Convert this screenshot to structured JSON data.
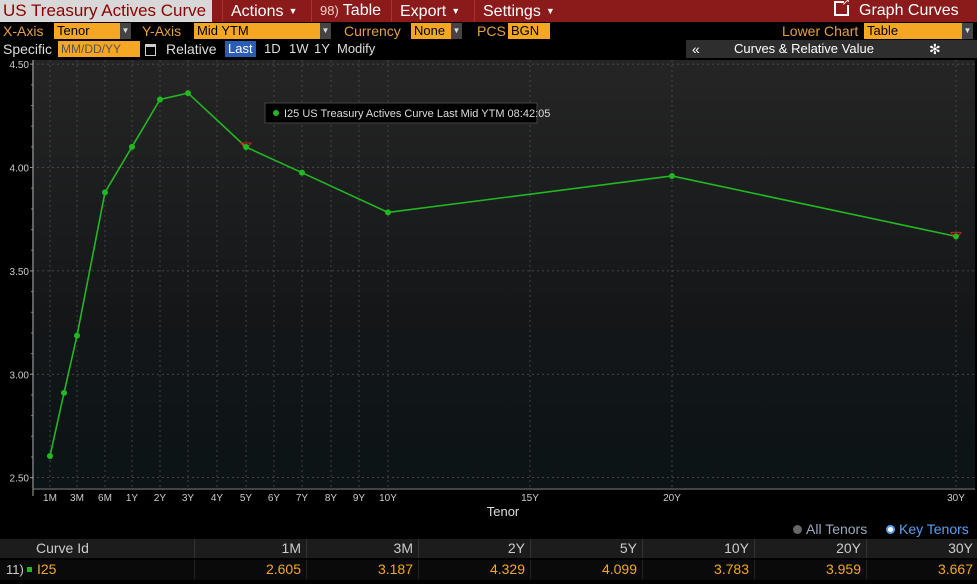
{
  "menu": {
    "title": "US Treasury Actives Curve",
    "actions": "Actions",
    "table_num": "98)",
    "table": "Table",
    "export": "Export",
    "settings": "Settings",
    "graph_curves": "Graph Curves"
  },
  "settings_row": {
    "xaxis_label": "X-Axis",
    "xaxis_value": "Tenor",
    "yaxis_label": "Y-Axis",
    "yaxis_value": "Mid YTM",
    "currency_label": "Currency",
    "currency_value": "None",
    "pcs_label": "PCS",
    "pcs_value": "BGN",
    "lower_chart_label": "Lower Chart",
    "lower_chart_value": "Table"
  },
  "row3": {
    "specific": "Specific",
    "date_placeholder": "MM/DD/YY",
    "relative": "Relative",
    "last": "Last",
    "d1": "1D",
    "w1": "1W",
    "y1": "1Y",
    "modify": "Modify",
    "panel_arrow": "«",
    "panel_title": "Curves & Relative Value"
  },
  "colors": {
    "menubar": "#8b1a1a",
    "accent": "#f5a623",
    "series": "#22b822",
    "selected": "#2a5cb8"
  },
  "chart_data": {
    "type": "line",
    "tooltip": "I25 US Treasury Actives Curve Last Mid YTM 08:42:05",
    "xlabel": "Tenor",
    "ylim": [
      2.45,
      4.52
    ],
    "yticks": [
      "2.50",
      "3.00",
      "3.50",
      "4.00",
      "4.50"
    ],
    "x_ticks": [
      "1M",
      "3M",
      "6M",
      "1Y",
      "2Y",
      "3Y",
      "4Y",
      "5Y",
      "6Y",
      "7Y",
      "8Y",
      "9Y",
      "10Y",
      "15Y",
      "20Y",
      "30Y"
    ],
    "series": [
      {
        "name": "I25",
        "points": [
          {
            "x": "1M",
            "y": 2.605
          },
          {
            "x": "2M",
            "y": 2.91
          },
          {
            "x": "3M",
            "y": 3.187
          },
          {
            "x": "6M",
            "y": 3.88
          },
          {
            "x": "1Y",
            "y": 4.1
          },
          {
            "x": "2Y",
            "y": 4.329
          },
          {
            "x": "3Y",
            "y": 4.36
          },
          {
            "x": "5Y",
            "y": 4.099
          },
          {
            "x": "7Y",
            "y": 3.975
          },
          {
            "x": "10Y",
            "y": 3.783
          },
          {
            "x": "20Y",
            "y": 3.959
          },
          {
            "x": "30Y",
            "y": 3.667
          }
        ]
      }
    ],
    "key_tenors": [
      "5Y",
      "30Y"
    ]
  },
  "legend": {
    "all_tenors": "All Tenors",
    "key_tenors": "Key Tenors"
  },
  "table": {
    "curve_header": "Curve Id",
    "columns": [
      "1M",
      "3M",
      "2Y",
      "5Y",
      "10Y",
      "20Y",
      "30Y"
    ],
    "row_num": "11)",
    "row_id": "I25",
    "values": [
      "2.605",
      "3.187",
      "4.329",
      "4.099",
      "3.783",
      "3.959",
      "3.667"
    ]
  }
}
